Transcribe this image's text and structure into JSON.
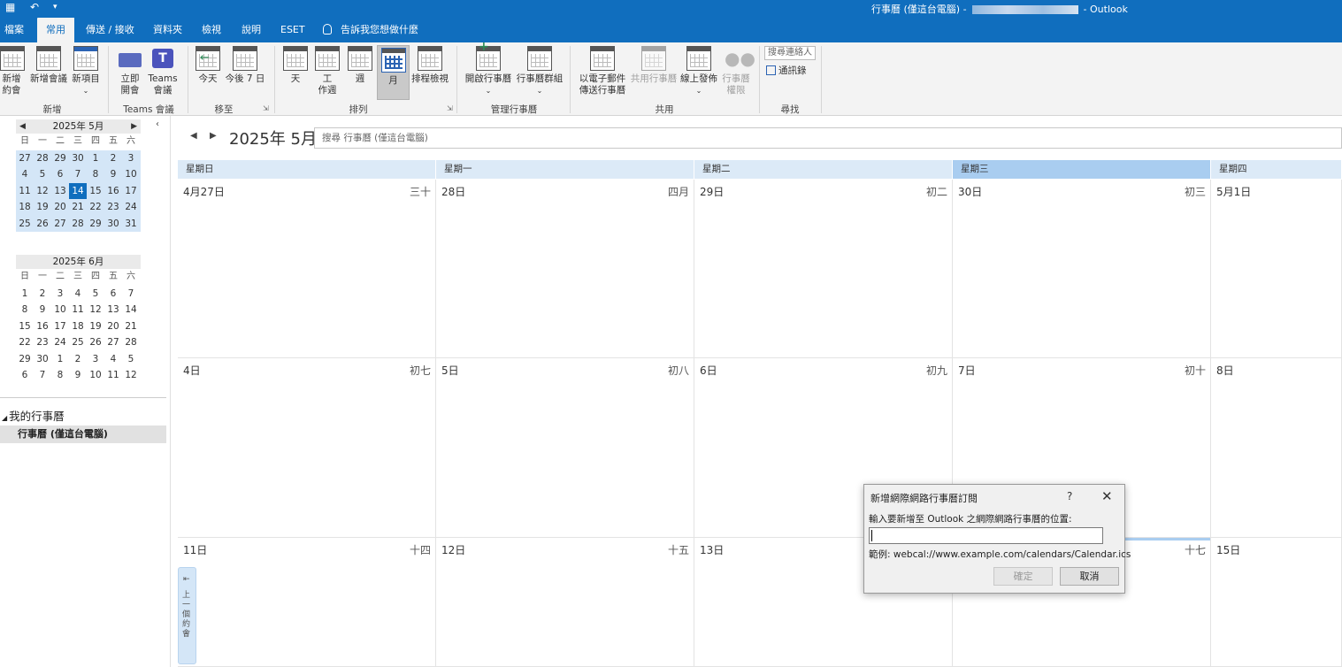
{
  "titlebar": {
    "title_prefix": "行事曆 (僅這台電腦) -",
    "title_suffix": "-  Outlook",
    "qa_icons": [
      "calendar-app-icon",
      "undo-icon",
      "customize-icon"
    ]
  },
  "tabs": [
    "檔案",
    "常用",
    "傳送 / 接收",
    "資料夾",
    "檢視",
    "說明",
    "ESET"
  ],
  "tell_me": "告訴我您想做什麼",
  "ribbon": {
    "new_appointment": "新增\n約會",
    "new_meeting": "新增會議",
    "new_items": "新項目",
    "group_new": "新增",
    "meet_now": "立即\n開會",
    "teams_meeting": "Teams\n會議",
    "group_teams": "Teams 會議",
    "today": "今天",
    "next_7_days": "今後 7 日",
    "group_goto": "移至",
    "day": "天",
    "work_week": "工\n作週",
    "week": "週",
    "month": "月",
    "schedule_view": "排程檢視",
    "group_arrange": "排列",
    "open_calendar": "開啟行事曆",
    "calendar_groups": "行事曆群組",
    "group_manage": "管理行事曆",
    "email_calendar": "以電子郵件\n傳送行事曆",
    "share_calendar": "共用行事曆",
    "publish_online": "線上發佈",
    "calendar_permissions": "行事曆\n權限",
    "group_share": "共用",
    "search_people_placeholder": "搜尋連絡人",
    "address_book": "通訊錄",
    "group_find": "尋找"
  },
  "minical": {
    "may_title": "2025年 5月",
    "june_title": "2025年 6月",
    "dow": [
      "日",
      "一",
      "二",
      "三",
      "四",
      "五",
      "六"
    ],
    "may_weeks": [
      [
        "27",
        "28",
        "29",
        "30",
        "1",
        "2",
        "3"
      ],
      [
        "4",
        "5",
        "6",
        "7",
        "8",
        "9",
        "10"
      ],
      [
        "11",
        "12",
        "13",
        "14",
        "15",
        "16",
        "17"
      ],
      [
        "18",
        "19",
        "20",
        "21",
        "22",
        "23",
        "24"
      ],
      [
        "25",
        "26",
        "27",
        "28",
        "29",
        "30",
        "31"
      ]
    ],
    "june_weeks": [
      [
        "1",
        "2",
        "3",
        "4",
        "5",
        "6",
        "7"
      ],
      [
        "8",
        "9",
        "10",
        "11",
        "12",
        "13",
        "14"
      ],
      [
        "15",
        "16",
        "17",
        "18",
        "19",
        "20",
        "21"
      ],
      [
        "22",
        "23",
        "24",
        "25",
        "26",
        "27",
        "28"
      ],
      [
        "29",
        "30",
        "1",
        "2",
        "3",
        "4",
        "5"
      ],
      [
        "6",
        "7",
        "8",
        "9",
        "10",
        "11",
        "12"
      ]
    ],
    "today": "14"
  },
  "folders": {
    "my_calendars": "我的行事曆",
    "calendar_item": "行事曆 (僅這台電腦)"
  },
  "main": {
    "month_title": "2025年 5月",
    "search_placeholder": "搜尋 行事曆 (僅這台電腦)",
    "day_headers": [
      "星期日",
      "星期一",
      "星期二",
      "星期三",
      "星期四"
    ],
    "current_day_index": 3,
    "weeks": [
      [
        [
          "4月27日",
          "三十"
        ],
        [
          "28日",
          "四月"
        ],
        [
          "29日",
          "初二"
        ],
        [
          "30日",
          "初三"
        ],
        [
          "5月1日",
          ""
        ]
      ],
      [
        [
          "4日",
          "初七"
        ],
        [
          "5日",
          "初八"
        ],
        [
          "6日",
          "初九"
        ],
        [
          "7日",
          "初十"
        ],
        [
          "8日",
          ""
        ]
      ],
      [
        [
          "11日",
          "十四"
        ],
        [
          "12日",
          "十五"
        ],
        [
          "13日",
          ""
        ],
        [
          "",
          "十七"
        ],
        [
          "15日",
          ""
        ]
      ]
    ],
    "prev_appointment": "上一個約會"
  },
  "dialog": {
    "title": "新增網際網路行事曆訂閱",
    "help": "?",
    "prompt": "輸入要新增至 Outlook 之網際網路行事曆的位置:",
    "url_value": "",
    "example": "範例: webcal://www.example.com/calendars/Calendar.ics",
    "ok": "確定",
    "cancel": "取消"
  }
}
